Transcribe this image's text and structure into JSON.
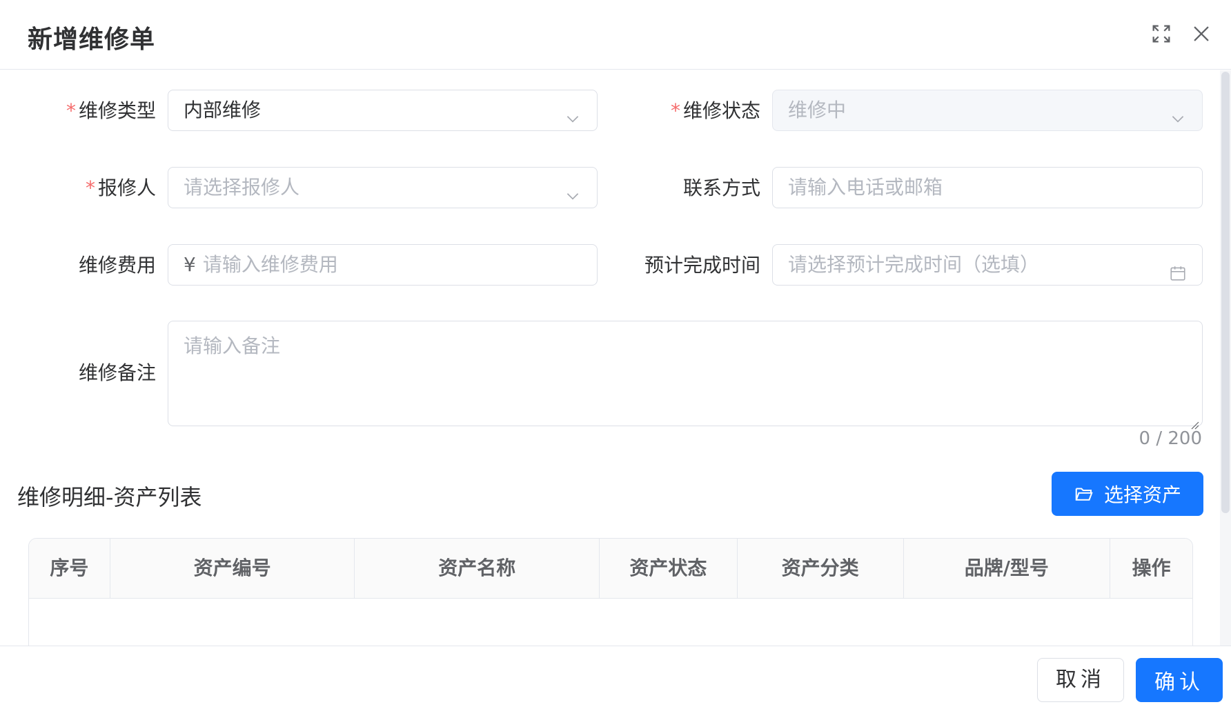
{
  "dialog": {
    "title": "新增维修单",
    "icons": {
      "maximize": "expand-icon",
      "close": "close-icon"
    }
  },
  "form": {
    "repair_type": {
      "label": "维修类型",
      "required_mark": "*",
      "value": "内部维修",
      "icon": "chevron-down-icon"
    },
    "repair_status": {
      "label": "维修状态",
      "required_mark": "*",
      "value": "维修中",
      "disabled": true,
      "icon": "chevron-down-icon"
    },
    "reporter": {
      "label": "报修人",
      "required_mark": "*",
      "placeholder": "请选择报修人",
      "icon": "chevron-down-icon"
    },
    "contact": {
      "label": "联系方式",
      "placeholder": "请输入电话或邮箱"
    },
    "cost": {
      "label": "维修费用",
      "prefix": "¥",
      "placeholder": "请输入维修费用"
    },
    "eta": {
      "label": "预计完成时间",
      "placeholder": "请选择预计完成时间（选填）",
      "icon": "calendar-icon"
    },
    "remark": {
      "label": "维修备注",
      "placeholder": "请输入备注",
      "counter": "0 / 200"
    }
  },
  "assets": {
    "section_title": "维修明细-资产列表",
    "select_button": "选择资产",
    "select_icon": "folder-open-icon",
    "columns": [
      "序号",
      "资产编号",
      "资产名称",
      "资产状态",
      "资产分类",
      "品牌/型号",
      "操作"
    ],
    "rows": []
  },
  "footer": {
    "cancel": "取消",
    "confirm": "确认"
  },
  "colors": {
    "primary": "#1677ff",
    "required": "#f56c6c",
    "border": "#dcdfe6",
    "placeholder": "#b4b8c0"
  }
}
